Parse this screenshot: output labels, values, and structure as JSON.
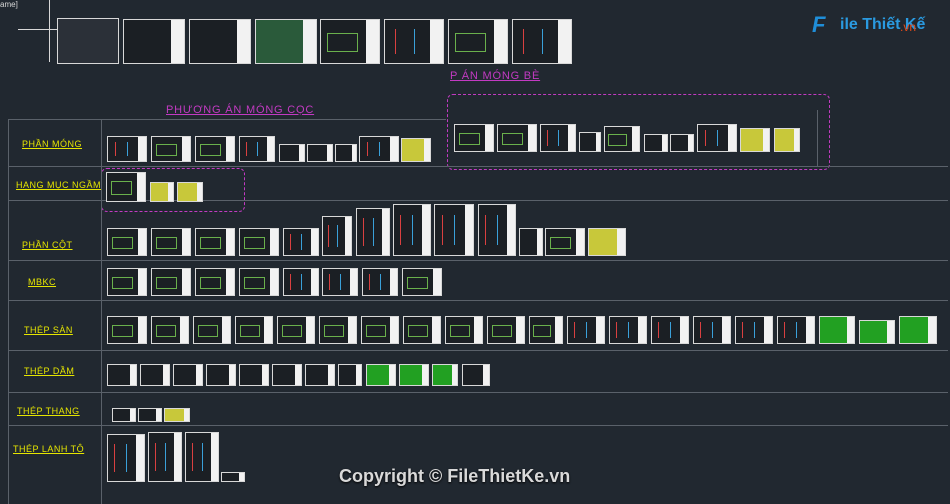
{
  "top_tag": "ame]",
  "labels": {
    "phuong_an_mong_coc": "PHƯƠNG ÁN MÓNG CỌC",
    "p_an_mong_be": "P ÁN MÓNG BÈ",
    "phan_mong": "PHẦN MÓNG",
    "hang_muc_ngam": "HẠNG MỤC NGẦM",
    "phan_cot": "PHẦN CỘT",
    "mbkc": "MBKC",
    "thep_san": "THÉP SÀN",
    "thep_dam": "THÉP DẦM",
    "thep_thang": "THÉP THANG",
    "thep_lanh_to": "THÉP LANH TÔ"
  },
  "logo": {
    "initial": "F",
    "name": "ile Thiết Kế",
    "suffix": ".vn"
  },
  "watermark": "Copyright © FileThietKe.vn",
  "colors": {
    "background": "#212830",
    "label_yellow": "#e6e600",
    "group_magenta": "#c23ac2",
    "grid_line": "#5a616a"
  }
}
